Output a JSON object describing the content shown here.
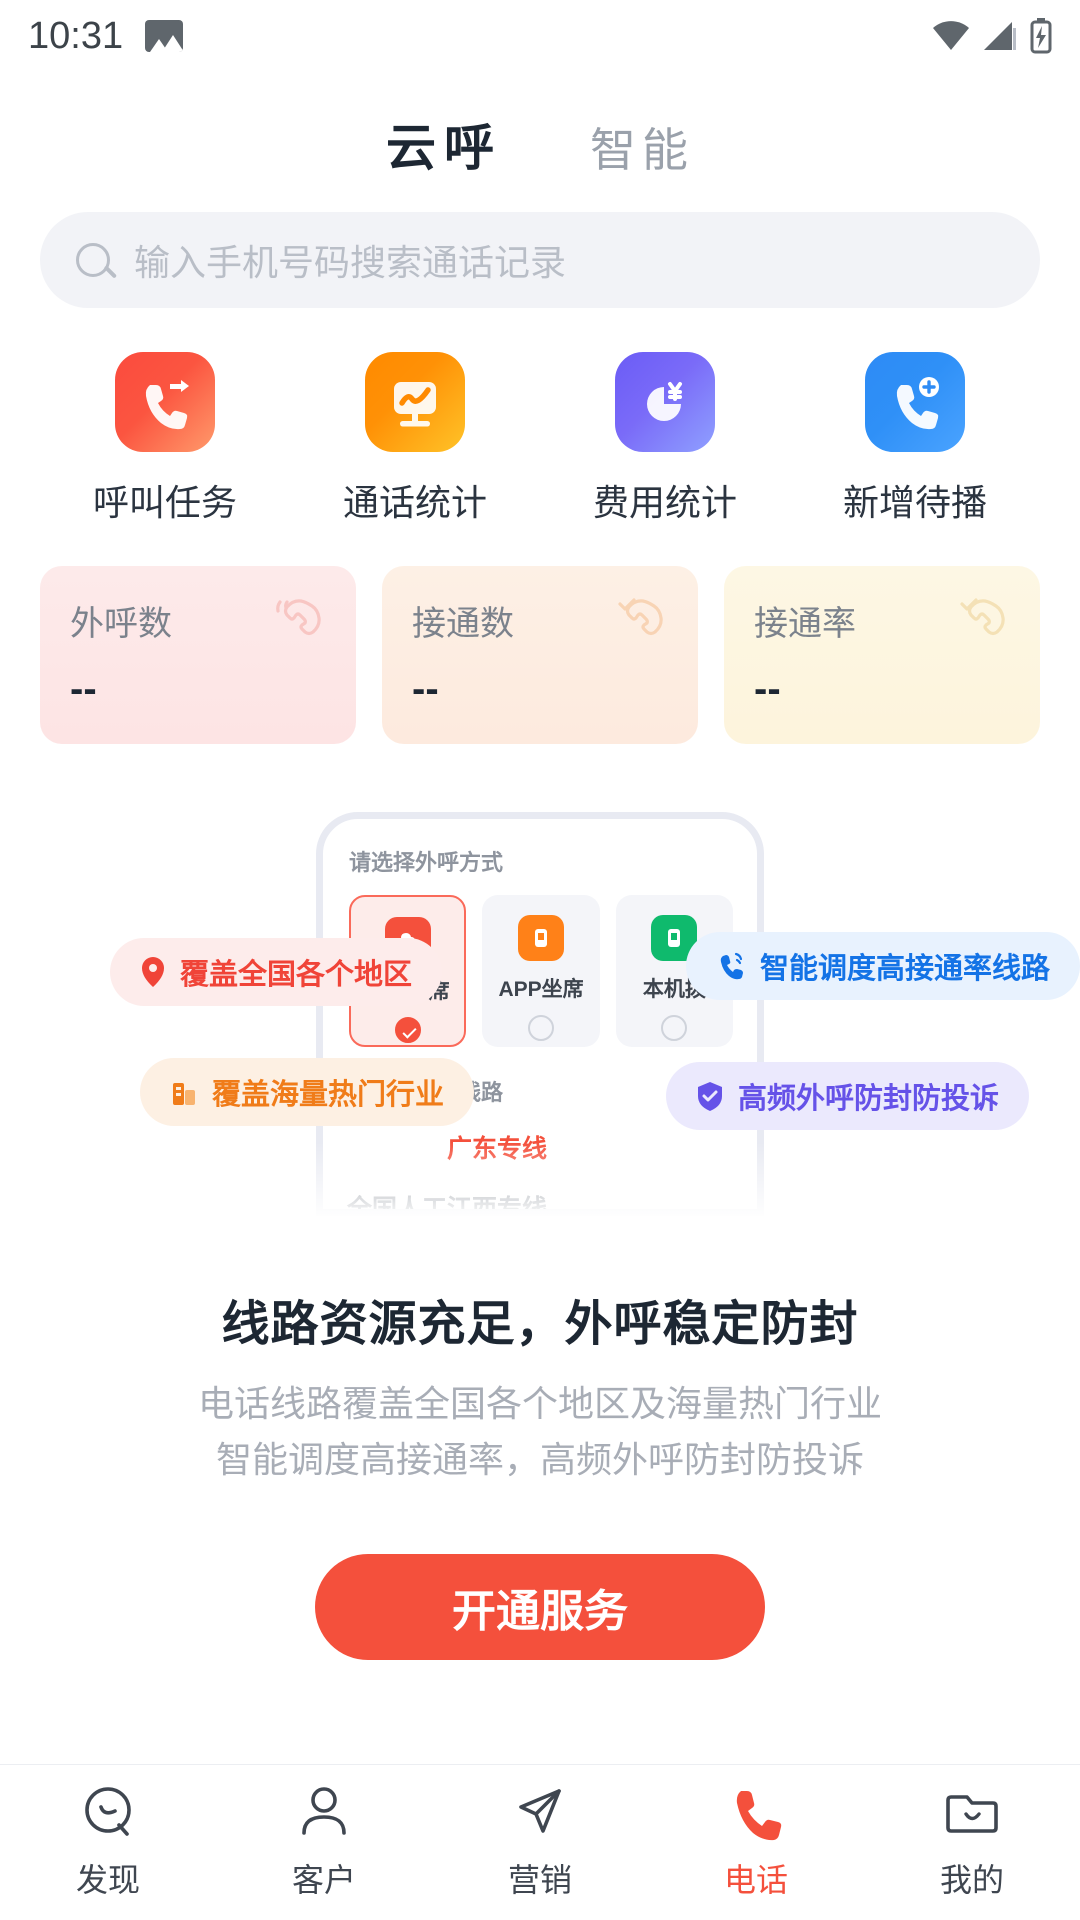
{
  "status_bar": {
    "time": "10:31",
    "photo_icon": "image-icon",
    "wifi_icon": "wifi-icon",
    "signal_icon": "signal-icon",
    "battery_icon": "battery-charging-icon"
  },
  "tabs": [
    {
      "label": "云呼",
      "active": true
    },
    {
      "label": "智能",
      "active": false
    }
  ],
  "search": {
    "placeholder": "输入手机号码搜索通话记录",
    "value": "",
    "icon": "search-icon"
  },
  "quick_actions": [
    {
      "label": "呼叫任务",
      "icon": "phone-outgoing-icon",
      "color": "#fb4b3e"
    },
    {
      "label": "通话统计",
      "icon": "monitor-chart-icon",
      "color": "#ff8a00"
    },
    {
      "label": "费用统计",
      "icon": "pie-chart-yuan-icon",
      "color": "#6b5cf6"
    },
    {
      "label": "新增待播",
      "icon": "phone-add-icon",
      "color": "#2d8bf5"
    }
  ],
  "stats": [
    {
      "title": "外呼数",
      "value": "--",
      "icon": "phone-call-icon",
      "color": "#f6b8b6"
    },
    {
      "title": "接通数",
      "value": "--",
      "icon": "phone-check-icon",
      "color": "#f8c79b"
    },
    {
      "title": "接通率",
      "value": "--",
      "icon": "phone-rate-icon",
      "color": "#f3d69a"
    }
  ],
  "promo": {
    "phone_mock": {
      "section1_label": "请选择外呼方式",
      "options": [
        {
          "label": "云呼坐席",
          "selected": true,
          "icon": "cloud-seat-icon"
        },
        {
          "label": "APP坐席",
          "selected": false,
          "icon": "app-seat-icon"
        },
        {
          "label": "本机拨",
          "selected": false,
          "icon": "device-seat-icon"
        }
      ],
      "section2_label": "请选择外呼线路",
      "line1": "广东专线",
      "line2": "全国人工江西专线"
    },
    "badges": [
      {
        "text": "覆盖全国各个地区",
        "icon": "location-pin-icon",
        "color": "#f04438"
      },
      {
        "text": "智能调度高接通率线路",
        "icon": "phone-signal-icon",
        "color": "#1473e6"
      },
      {
        "text": "覆盖海量热门行业",
        "icon": "building-icon",
        "color": "#f07c19"
      },
      {
        "text": "高频外呼防封防投诉",
        "icon": "shield-check-icon",
        "color": "#6552e8"
      }
    ],
    "headline": "线路资源充足，外呼稳定防封",
    "sub_line1": "电话线路覆盖全国各个地区及海量热门行业",
    "sub_line2": "智能调度高接通率，高频外呼防封防投诉"
  },
  "cta": {
    "label": "开通服务",
    "color": "#f4503c"
  },
  "bottom_nav": [
    {
      "label": "发现",
      "icon": "discover-icon",
      "active": false
    },
    {
      "label": "客户",
      "icon": "customer-icon",
      "active": false
    },
    {
      "label": "营销",
      "icon": "marketing-send-icon",
      "active": false
    },
    {
      "label": "电话",
      "icon": "phone-icon",
      "active": true
    },
    {
      "label": "我的",
      "icon": "profile-folder-icon",
      "active": false
    }
  ]
}
